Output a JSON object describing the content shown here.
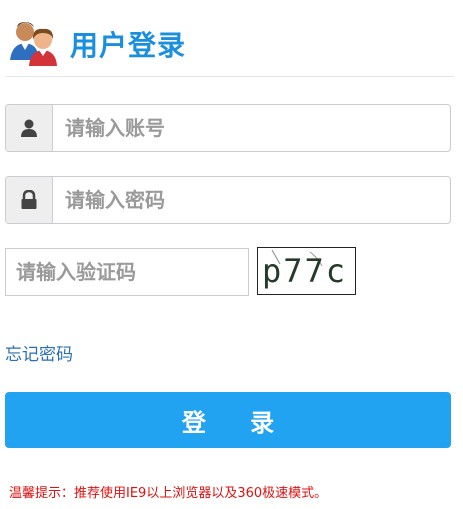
{
  "header": {
    "title": "用户登录"
  },
  "form": {
    "username_placeholder": "请输入账号",
    "password_placeholder": "请输入密码",
    "captcha_placeholder": "请输入验证码",
    "captcha_text": "p77c",
    "forgot_label": "忘记密码",
    "login_label": "登 录"
  },
  "footer": {
    "tip": "温馨提示：推荐使用IE9以上浏览器以及360极速模式。"
  },
  "icons": {
    "logo": "users-icon",
    "username": "user-icon",
    "password": "lock-icon"
  },
  "colors": {
    "title": "#1a8fe0",
    "button": "#21a3f1",
    "tip": "#e01010",
    "link": "#2a6fb1"
  }
}
